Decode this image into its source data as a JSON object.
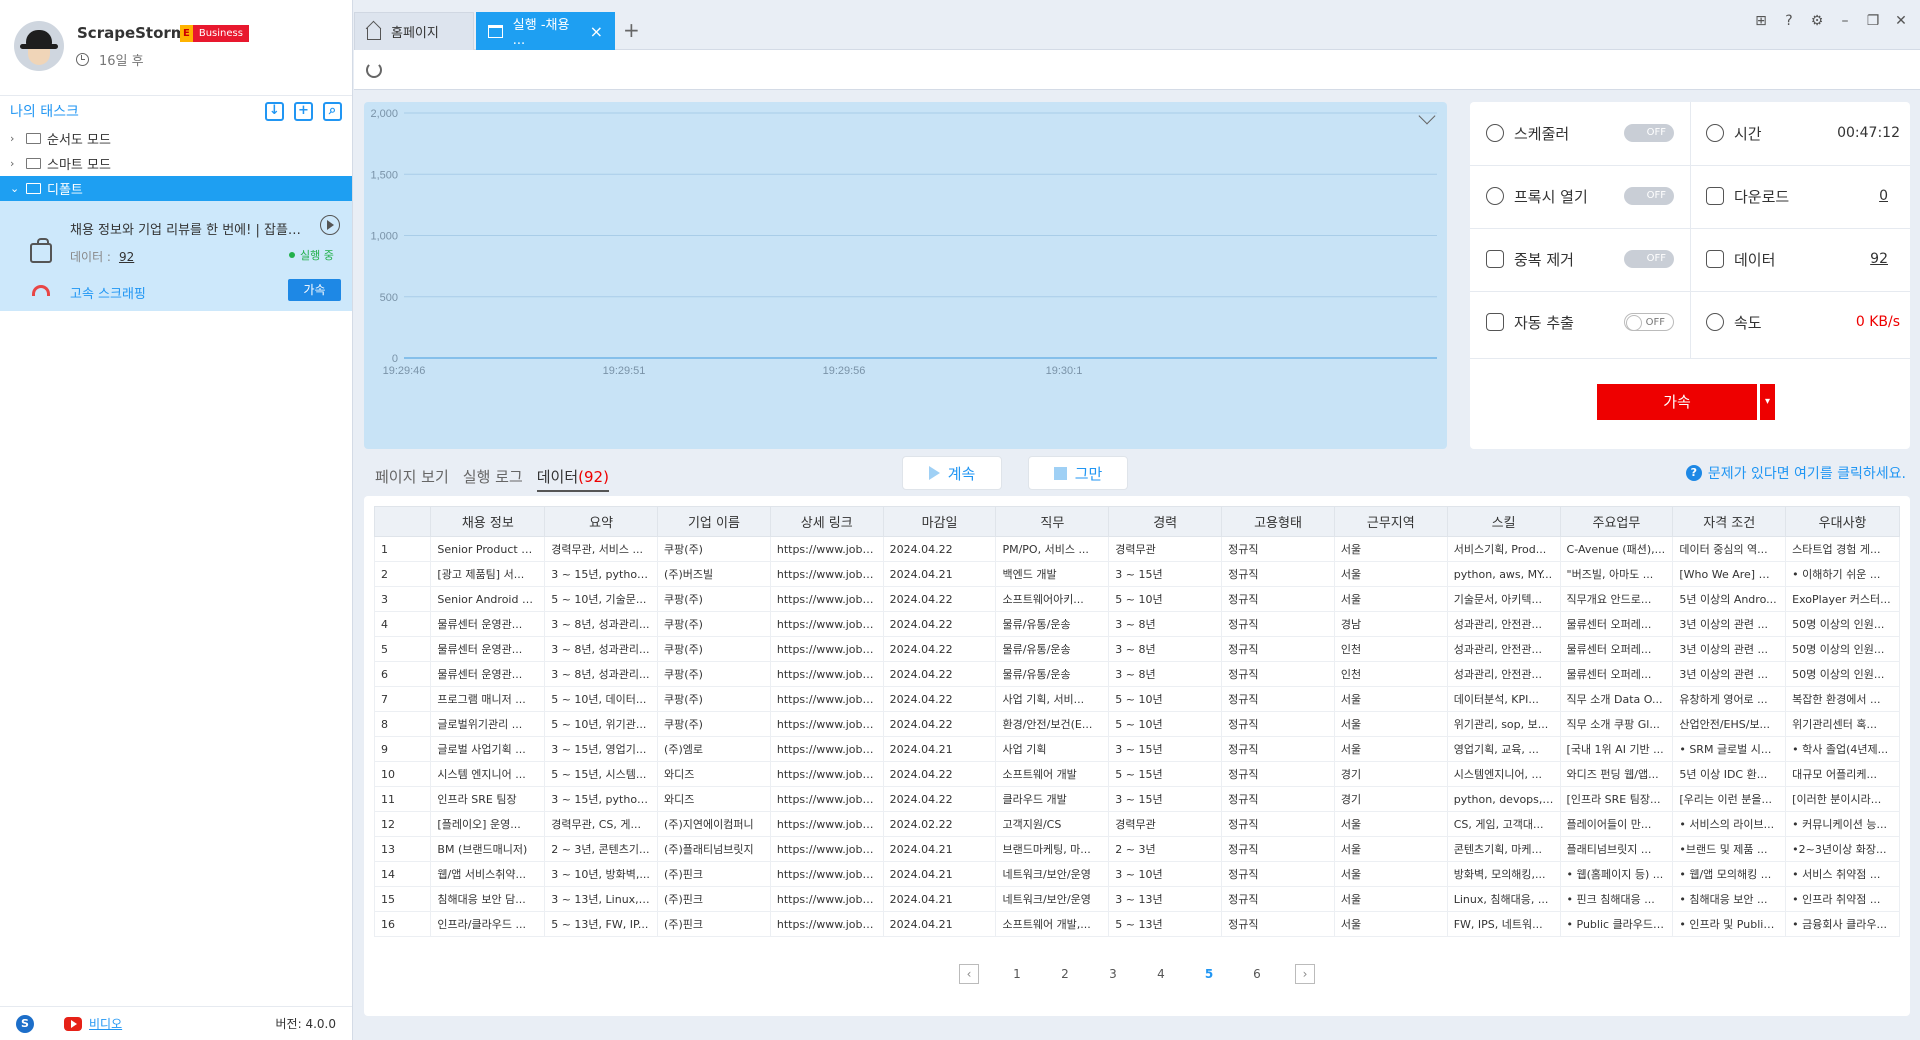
{
  "sidebar": {
    "app_name": "ScrapeStorm",
    "edition_letter": "E",
    "edition": "Business",
    "expire": "16일 후",
    "task_header": "나의 태스크",
    "tree": [
      {
        "label": "순서도 모드"
      },
      {
        "label": "스마트 모드"
      },
      {
        "label": "디폴트"
      }
    ],
    "task": {
      "name": "채용 정보와 기업 리뷰를 한 번에! | 잡플래닛",
      "data_label": "데이터 :",
      "data_count": "92",
      "status": "실행 중",
      "fast_label": "고속 스크래핑",
      "accel_label": "가속"
    },
    "footer": {
      "skype": "S",
      "video": "비디오",
      "version": "버전: 4.0.0"
    }
  },
  "tabs": {
    "home": "홈페이지",
    "run": "실행 -채용 ...",
    "close": "×",
    "new": "+"
  },
  "chart_data": {
    "type": "line",
    "yticks": [
      "2,000",
      "1,500",
      "1,000",
      "500",
      "0"
    ],
    "xticks": [
      "19:29:46",
      "19:29:51",
      "19:29:56",
      "19:30:1"
    ],
    "ylim": [
      0,
      2000
    ],
    "x": [
      "19:29:46",
      "19:29:51",
      "19:29:56",
      "19:30:1"
    ],
    "values": [
      0,
      0,
      0,
      0
    ],
    "grid": true
  },
  "stats": {
    "scheduler": "스케줄러",
    "scheduler_state": "OFF",
    "time_label": "시간",
    "time_value": "00:47:12",
    "proxy": "프록시 열기",
    "proxy_state": "OFF",
    "download_label": "다운로드",
    "download_value": "0",
    "dedupe": "중복 제거",
    "dedupe_state": "OFF",
    "data_label": "데이터",
    "data_value": "92",
    "auto_extract": "자동 추출",
    "auto_extract_state": "OFF",
    "speed_label": "속도",
    "speed_value": "0 KB/s",
    "accel_label": "가속",
    "accel_drop": "▾"
  },
  "subtabs": {
    "page_view": "페이지 보기",
    "run_log": "실행 로그",
    "data": "데이터",
    "data_count": "(92)"
  },
  "controls": {
    "continue": "계속",
    "stop": "그만",
    "help": "문제가 있다면 여기를 클릭하세요."
  },
  "table": {
    "headers": [
      "",
      "채용 정보",
      "요약",
      "기업 이름",
      "상세 링크",
      "마감일",
      "직무",
      "경력",
      "고용형태",
      "근무지역",
      "스킬",
      "주요업무",
      "자격 조건",
      "우대사항"
    ],
    "rows": [
      [
        "1",
        "Senior Product M...",
        "경력무관, 서비스 ...",
        "쿠팡(주)",
        "https://www.jobpl...",
        "2024.04.22",
        "PM/PO, 서비스 ...",
        "경력무관",
        "정규직",
        "서울",
        "서비스기획, Prod...",
        "C-Avenue (패션),...",
        "데이터 중심의 역...",
        "스타트업 경험 게..."
      ],
      [
        "2",
        "[광고 제품팀] 서...",
        "3 ~ 15년, python,...",
        "(주)버즈빌",
        "https://www.jobpl...",
        "2024.04.21",
        "백엔드 개발",
        "3 ~ 15년",
        "정규직",
        "서울",
        "python, aws, MY...",
        "\"버즈빌, 아마도 ...",
        "[Who We Are] 광...",
        "• 이해하기 쉬운 ..."
      ],
      [
        "3",
        "Senior Android E...",
        "5 ~ 10년, 기술문...",
        "쿠팡(주)",
        "https://www.jobpl...",
        "2024.04.22",
        "소프트웨어아키...",
        "5 ~ 10년",
        "정규직",
        "서울",
        "기술문서, 아키텍...",
        "직무개요 안드로...",
        "5년 이상의 Andro...",
        "ExoPlayer 커스터..."
      ],
      [
        "4",
        "물류센터 운영관...",
        "3 ~ 8년, 성과관리...",
        "쿠팡(주)",
        "https://www.jobpl...",
        "2024.04.22",
        "물류/유통/운송",
        "3 ~ 8년",
        "정규직",
        "경남",
        "성과관리, 안전관...",
        "물류센터 오퍼레...",
        "3년 이상의 관련 ...",
        "50명 이상의 인원..."
      ],
      [
        "5",
        "물류센터 운영관...",
        "3 ~ 8년, 성과관리...",
        "쿠팡(주)",
        "https://www.jobpl...",
        "2024.04.22",
        "물류/유통/운송",
        "3 ~ 8년",
        "정규직",
        "인천",
        "성과관리, 안전관...",
        "물류센터 오퍼레...",
        "3년 이상의 관련 ...",
        "50명 이상의 인원..."
      ],
      [
        "6",
        "물류센터 운영관...",
        "3 ~ 8년, 성과관리...",
        "쿠팡(주)",
        "https://www.jobpl...",
        "2024.04.22",
        "물류/유통/운송",
        "3 ~ 8년",
        "정규직",
        "인천",
        "성과관리, 안전관...",
        "물류센터 오퍼레...",
        "3년 이상의 관련 ...",
        "50명 이상의 인원..."
      ],
      [
        "7",
        "프로그램 매니저 ...",
        "5 ~ 10년, 데이터...",
        "쿠팡(주)",
        "https://www.jobpl...",
        "2024.04.22",
        "사업 기획, 서비...",
        "5 ~ 10년",
        "정규직",
        "서울",
        "데이터분석, KPI...",
        "직무 소개 Data O...",
        "유창하게 영어로 ...",
        "복잡한 환경에서 ..."
      ],
      [
        "8",
        "글로벌위기관리 ...",
        "5 ~ 10년, 위기관...",
        "쿠팡(주)",
        "https://www.jobpl...",
        "2024.04.22",
        "환경/안전/보건(E...",
        "5 ~ 10년",
        "정규직",
        "서울",
        "위기관리, sop, 보...",
        "직무 소개 쿠팡 Gl...",
        "산업안전/EHS/보...",
        "위기관리센터 혹..."
      ],
      [
        "9",
        "글로벌 사업기획 ...",
        "3 ~ 15년, 영업기...",
        "(주)엠로",
        "https://www.jobpl...",
        "2024.04.21",
        "사업 기획",
        "3 ~ 15년",
        "정규직",
        "서울",
        "영업기획, 교육, ...",
        "[국내 1위 AI 기반 ...",
        "• SRM 글로벌 시...",
        "• 학사 졸업(4년제..."
      ],
      [
        "10",
        "시스템 엔지니어 ...",
        "5 ~ 15년, 시스템...",
        "와디즈",
        "https://www.jobpl...",
        "2024.04.22",
        "소프트웨어 개발",
        "5 ~ 15년",
        "정규직",
        "경기",
        "시스템엔지니어, ...",
        "와디즈 펀딩 웹/앱...",
        "5년 이상 IDC 환...",
        "대규모 어플리케..."
      ],
      [
        "11",
        "인프라 SRE 팀장",
        "3 ~ 15년, python,...",
        "와디즈",
        "https://www.jobpl...",
        "2024.04.22",
        "클라우드 개발",
        "3 ~ 15년",
        "정규직",
        "경기",
        "python, devops, ...",
        "[인프라 SRE 팀장...",
        "[우리는 이런 분을...",
        "[이러한 분이시라..."
      ],
      [
        "12",
        "[플레이오] 운영...",
        "경력무관, CS, 게...",
        "(주)지연에이컴퍼니",
        "https://www.jobpl...",
        "2024.02.22",
        "고객지원/CS",
        "경력무관",
        "정규직",
        "서울",
        "CS, 게임, 고객대...",
        "플레이어들이 만...",
        "• 서비스의 라이브...",
        "• 커뮤니케이션 능..."
      ],
      [
        "13",
        "BM (브랜드매니저)",
        "2 ~ 3년, 콘텐츠기...",
        "(주)플래티넘브릿지",
        "https://www.jobpl...",
        "2024.04.21",
        "브랜드마케팅, 마...",
        "2 ~ 3년",
        "정규직",
        "서울",
        "콘텐츠기획, 마케...",
        "플래티넘브릿지 ...",
        "•브랜드 및 제품 ...",
        "•2~3년이상 화장..."
      ],
      [
        "14",
        "웹/앱 서비스취약...",
        "3 ~ 10년, 방화벽,...",
        "(주)핀크",
        "https://www.jobpl...",
        "2024.04.21",
        "네트워크/보안/운영",
        "3 ~ 10년",
        "정규직",
        "서울",
        "방화벽, 모의해킹,...",
        "• 웹(홈페이지 등) ...",
        "• 웹/앱 모의해킹 ...",
        "• 서비스 취약점 ..."
      ],
      [
        "15",
        "침해대응 보안 담...",
        "3 ~ 13년, Linux, ...",
        "(주)핀크",
        "https://www.jobpl...",
        "2024.04.21",
        "네트워크/보안/운영",
        "3 ~ 13년",
        "정규직",
        "서울",
        "Linux, 침해대응, ...",
        "• 핀크 침해대응 ...",
        "• 침해대응 보안 ...",
        "• 인프라 취약점 ..."
      ],
      [
        "16",
        "인프라/클라우드 ...",
        "5 ~ 13년, FW, IP...",
        "(주)핀크",
        "https://www.jobpl...",
        "2024.04.21",
        "소프트웨어 개발,...",
        "5 ~ 13년",
        "정규직",
        "서울",
        "FW, IPS, 네트워...",
        "• Public 클라우드 ...",
        "• 인프라 및 Public...",
        "• 금융회사 클라우..."
      ]
    ]
  },
  "pager": {
    "pages": [
      "1",
      "2",
      "3",
      "4",
      "5",
      "6"
    ],
    "current": "5",
    "prev": "‹",
    "next": "›"
  },
  "colors": {
    "accent": "#1e9ff2",
    "danger": "#ee0000",
    "chart_bg": "#c8e3f6",
    "running": "#22b04b"
  }
}
